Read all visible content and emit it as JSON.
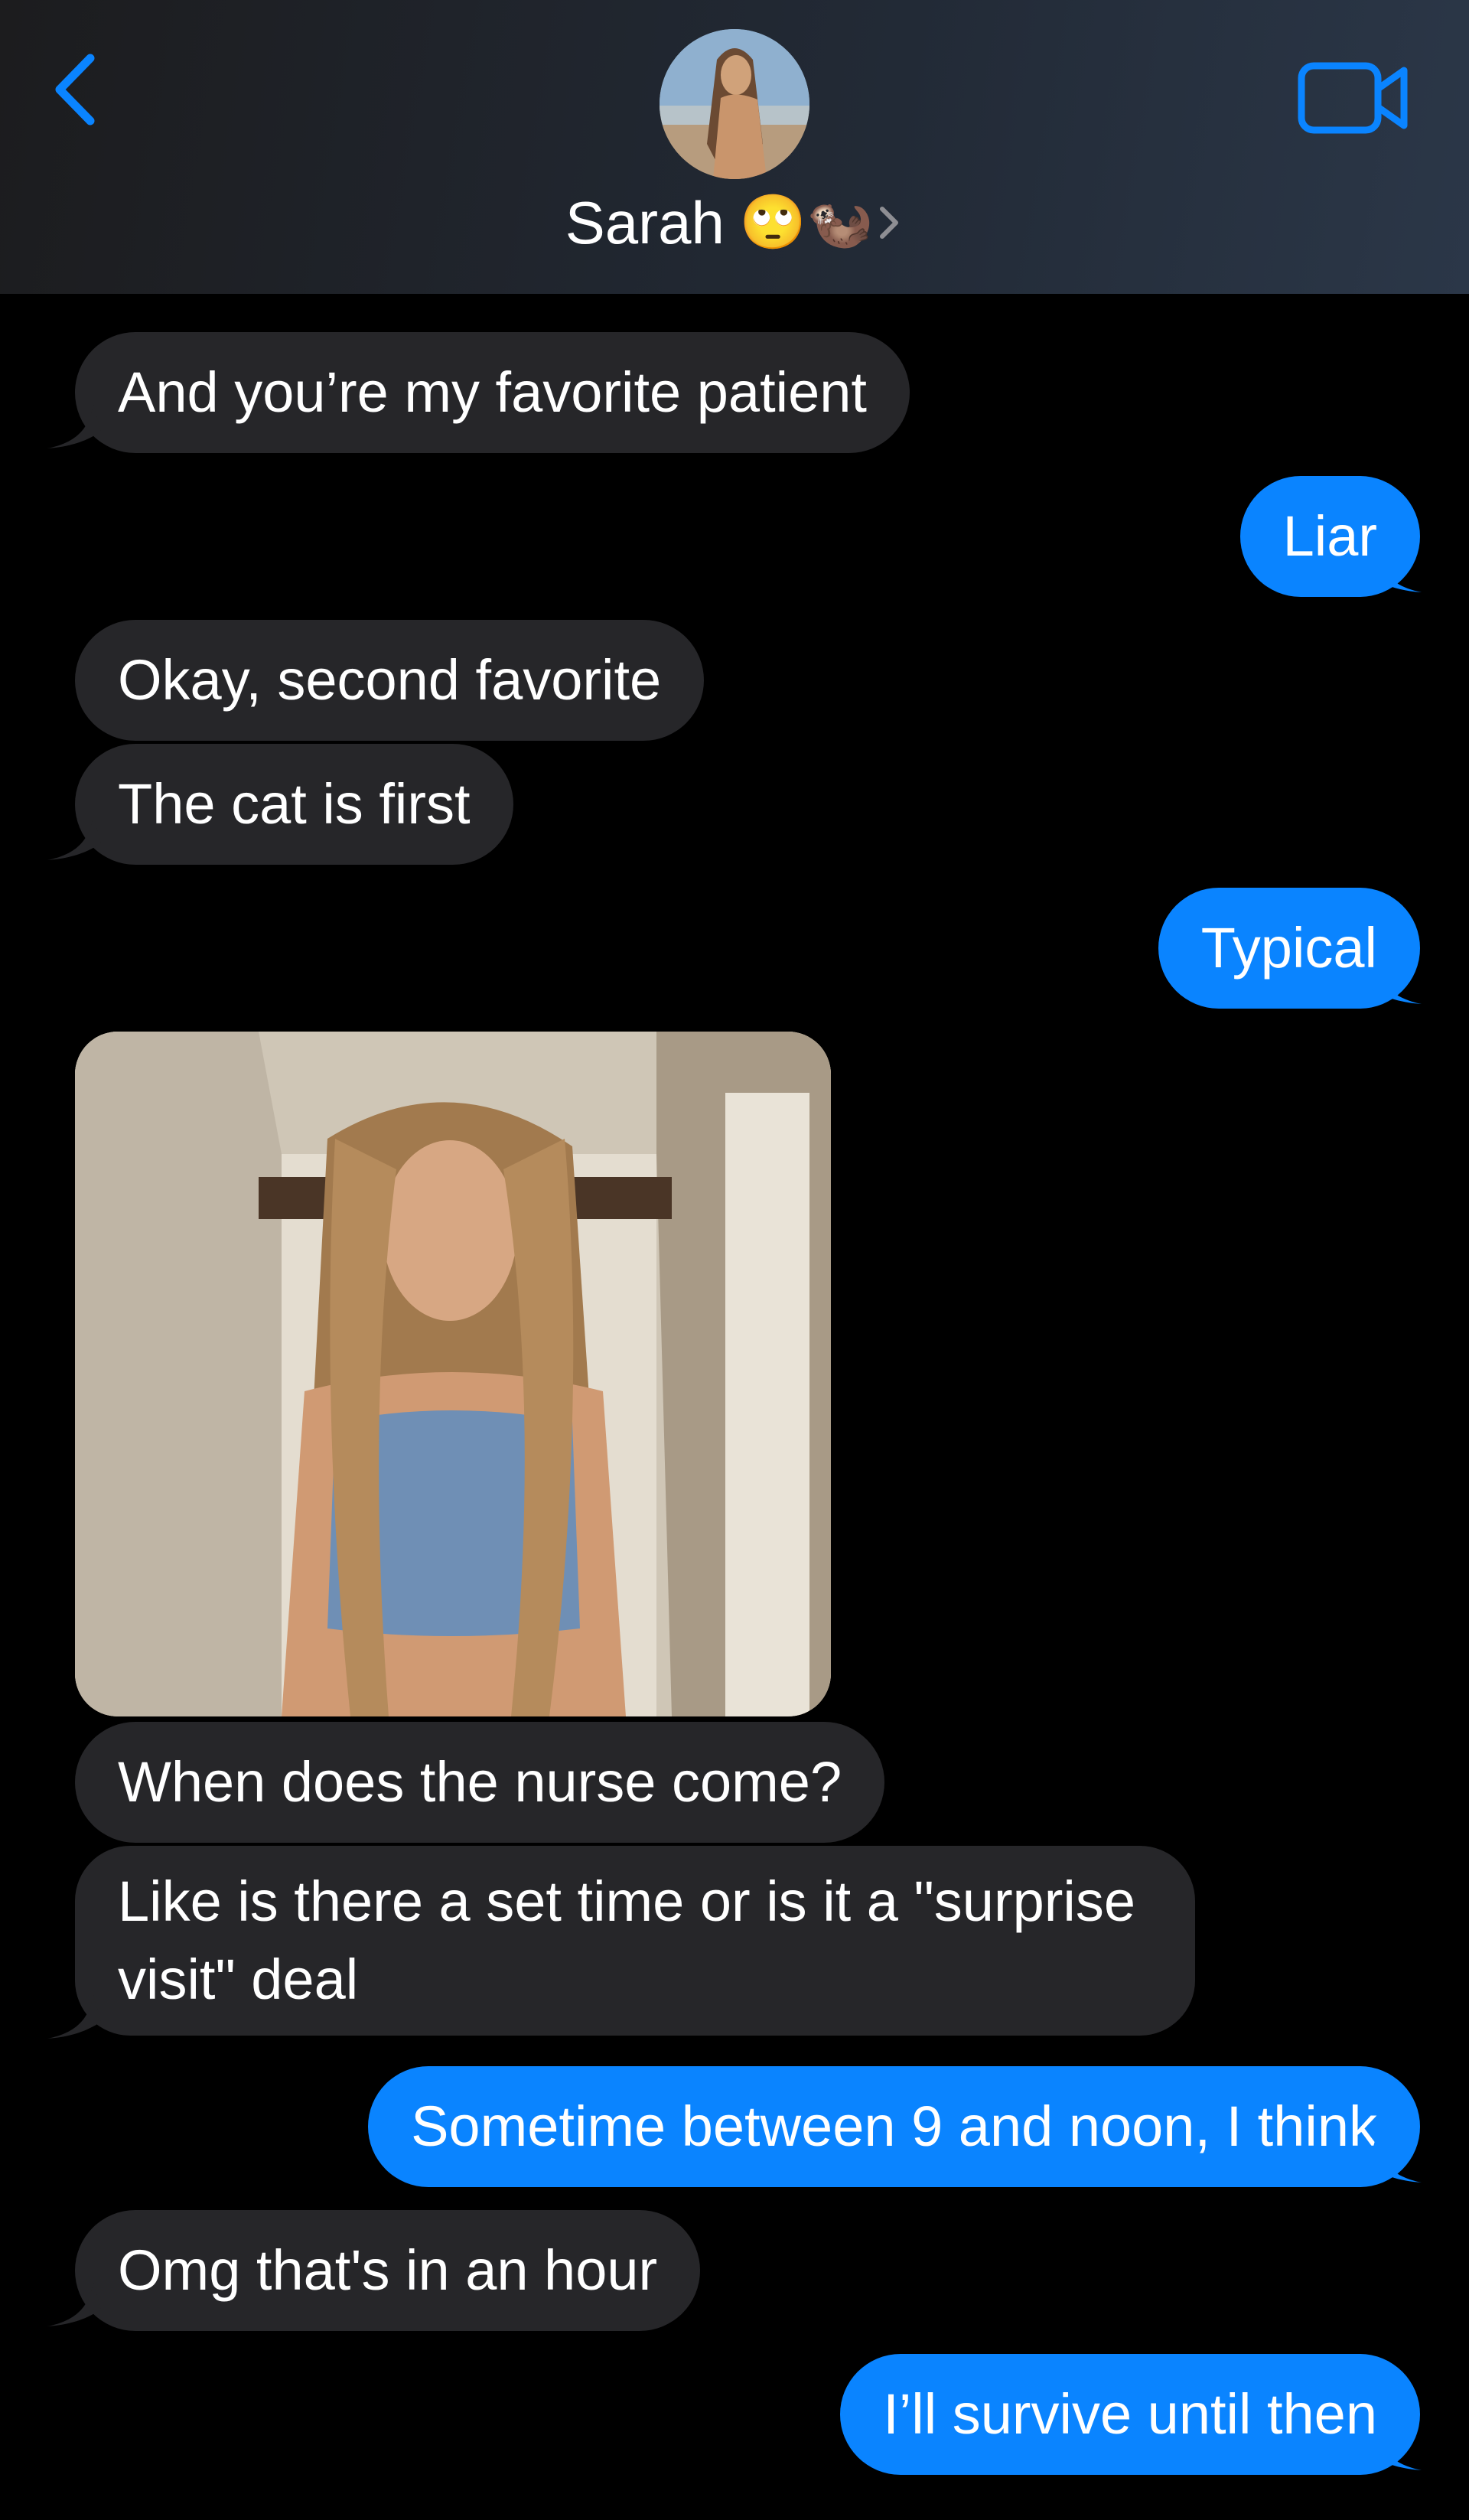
{
  "header": {
    "contact_name": "Sarah",
    "contact_emoji": "🙄🦦",
    "back_icon": "chevron-left-icon",
    "video_icon": "video-camera-icon",
    "accent_color": "#0a84ff"
  },
  "messages": [
    {
      "direction": "incoming",
      "text": "And you’re my favorite patient"
    },
    {
      "direction": "outgoing",
      "text": "Liar"
    },
    {
      "direction": "incoming",
      "text": "Okay, second favorite"
    },
    {
      "direction": "incoming",
      "text": "The cat is first"
    },
    {
      "direction": "outgoing",
      "text": "Typical"
    },
    {
      "direction": "incoming",
      "type": "photo"
    },
    {
      "direction": "incoming",
      "text": "When does the nurse come?"
    },
    {
      "direction": "incoming",
      "text": "Like is there a set time or is it a \"surprise visit\" deal"
    },
    {
      "direction": "outgoing",
      "text": "Sometime between 9 and noon, I think"
    },
    {
      "direction": "incoming",
      "text": "Omg that's in an hour"
    },
    {
      "direction": "outgoing",
      "text": "I’ll survive until then"
    }
  ],
  "colors": {
    "incoming_bubble": "#262629",
    "outgoing_bubble": "#0a84ff",
    "background": "#000000"
  }
}
